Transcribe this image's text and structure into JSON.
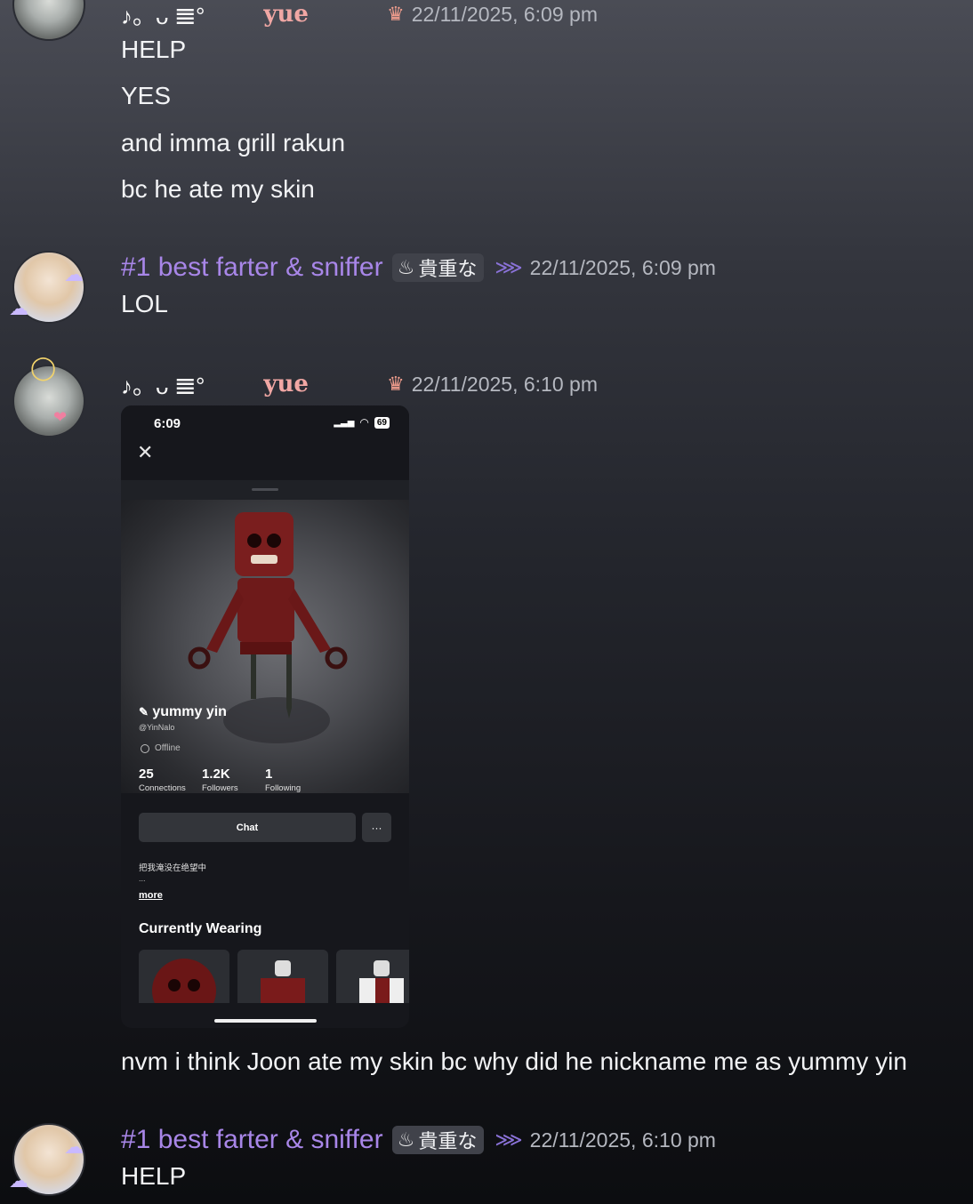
{
  "messages": [
    {
      "user": "yue",
      "decor_glyphs": "♪。ᴗ 𝌆°",
      "timestamp": "22/11/2025, 6:09 pm",
      "lines": [
        "HELP",
        "YES",
        "and imma grill rakun",
        "bc he ate my skin"
      ]
    },
    {
      "user": "#1 best farter & sniffer",
      "tag": "貴重な",
      "timestamp": "22/11/2025, 6:09 pm",
      "lines": [
        "LOL"
      ]
    },
    {
      "user": "yue",
      "decor_glyphs": "♪。ᴗ 𝌆°",
      "timestamp": "22/11/2025, 6:10 pm",
      "lines": [
        "nvm i think Joon ate my skin bc why did he nickname me as yummy yin"
      ]
    },
    {
      "user": "#1 best farter & sniffer",
      "tag": "貴重な",
      "timestamp": "22/11/2025, 6:10 pm",
      "lines": [
        "HELP"
      ]
    }
  ],
  "screenshot": {
    "time": "6:09",
    "battery": "69",
    "display_name": "yummy yin",
    "username": "@YinNalo",
    "presence": "Offline",
    "stats": [
      {
        "value": "25",
        "label": "Connections"
      },
      {
        "value": "1.2K",
        "label": "Followers"
      },
      {
        "value": "1",
        "label": "Following"
      }
    ],
    "chat_label": "Chat",
    "more_button": "···",
    "bio": "把我淹没在绝望中",
    "bio_ellipsis": "...",
    "more_link": "more",
    "wearing_heading": "Currently Wearing"
  },
  "colors": {
    "name_purple": "#a886e8",
    "yue_pink": "#f1a7a4",
    "timestamp": "#b5b8c0"
  }
}
